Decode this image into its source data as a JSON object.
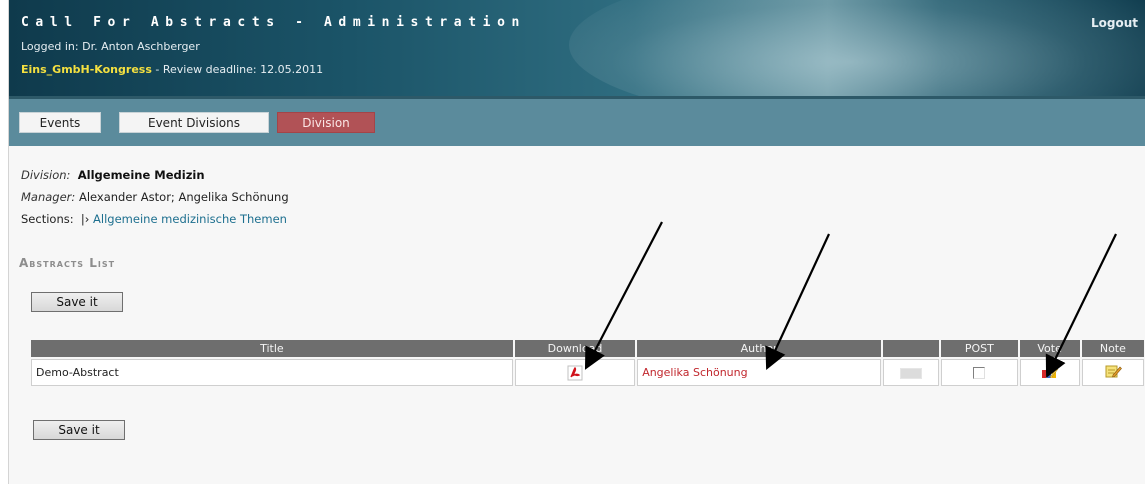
{
  "header": {
    "app_title": "Call For Abstracts - Administration",
    "logout_label": "Logout",
    "logged_in_label": "Logged in: Dr. Anton Aschberger",
    "event_name": "Eins_GmbH-Kongress",
    "deadline_text": " - Review deadline: 12.05.2011"
  },
  "nav": {
    "tabs": [
      {
        "label": "Events",
        "active": false
      },
      {
        "label": "Event Divisions",
        "active": false
      },
      {
        "label": "Division",
        "active": true
      }
    ]
  },
  "division": {
    "division_label": "Division:",
    "division_value": "Allgemeine Medizin",
    "manager_label": "Manager:",
    "manager_value": "Alexander Astor; Angelika Schönung",
    "sections_label": "Sections:",
    "sections_separator": "|›",
    "section_link": "Allgemeine medizinische Themen"
  },
  "abstracts": {
    "section_title": "Abstracts List",
    "save_label": "Save it",
    "columns": [
      "Title",
      "Download",
      "Author",
      "",
      "POST",
      "Vote",
      "Note"
    ],
    "rows": [
      {
        "title": "Demo-Abstract",
        "download_icon": "pdf-icon",
        "author": "Angelika Schönung",
        "post_checked": false,
        "vote_icon": "vote-chart-icon",
        "note_icon": "note-pencil-icon"
      }
    ]
  },
  "colors": {
    "header_dark": "#0f3a4c",
    "nav_bar": "#5b8b9c",
    "active_tab": "#b15256",
    "event_name": "#f4e040",
    "link": "#1d6f8f",
    "author": "#c1272d",
    "table_header": "#6e6e6e"
  }
}
